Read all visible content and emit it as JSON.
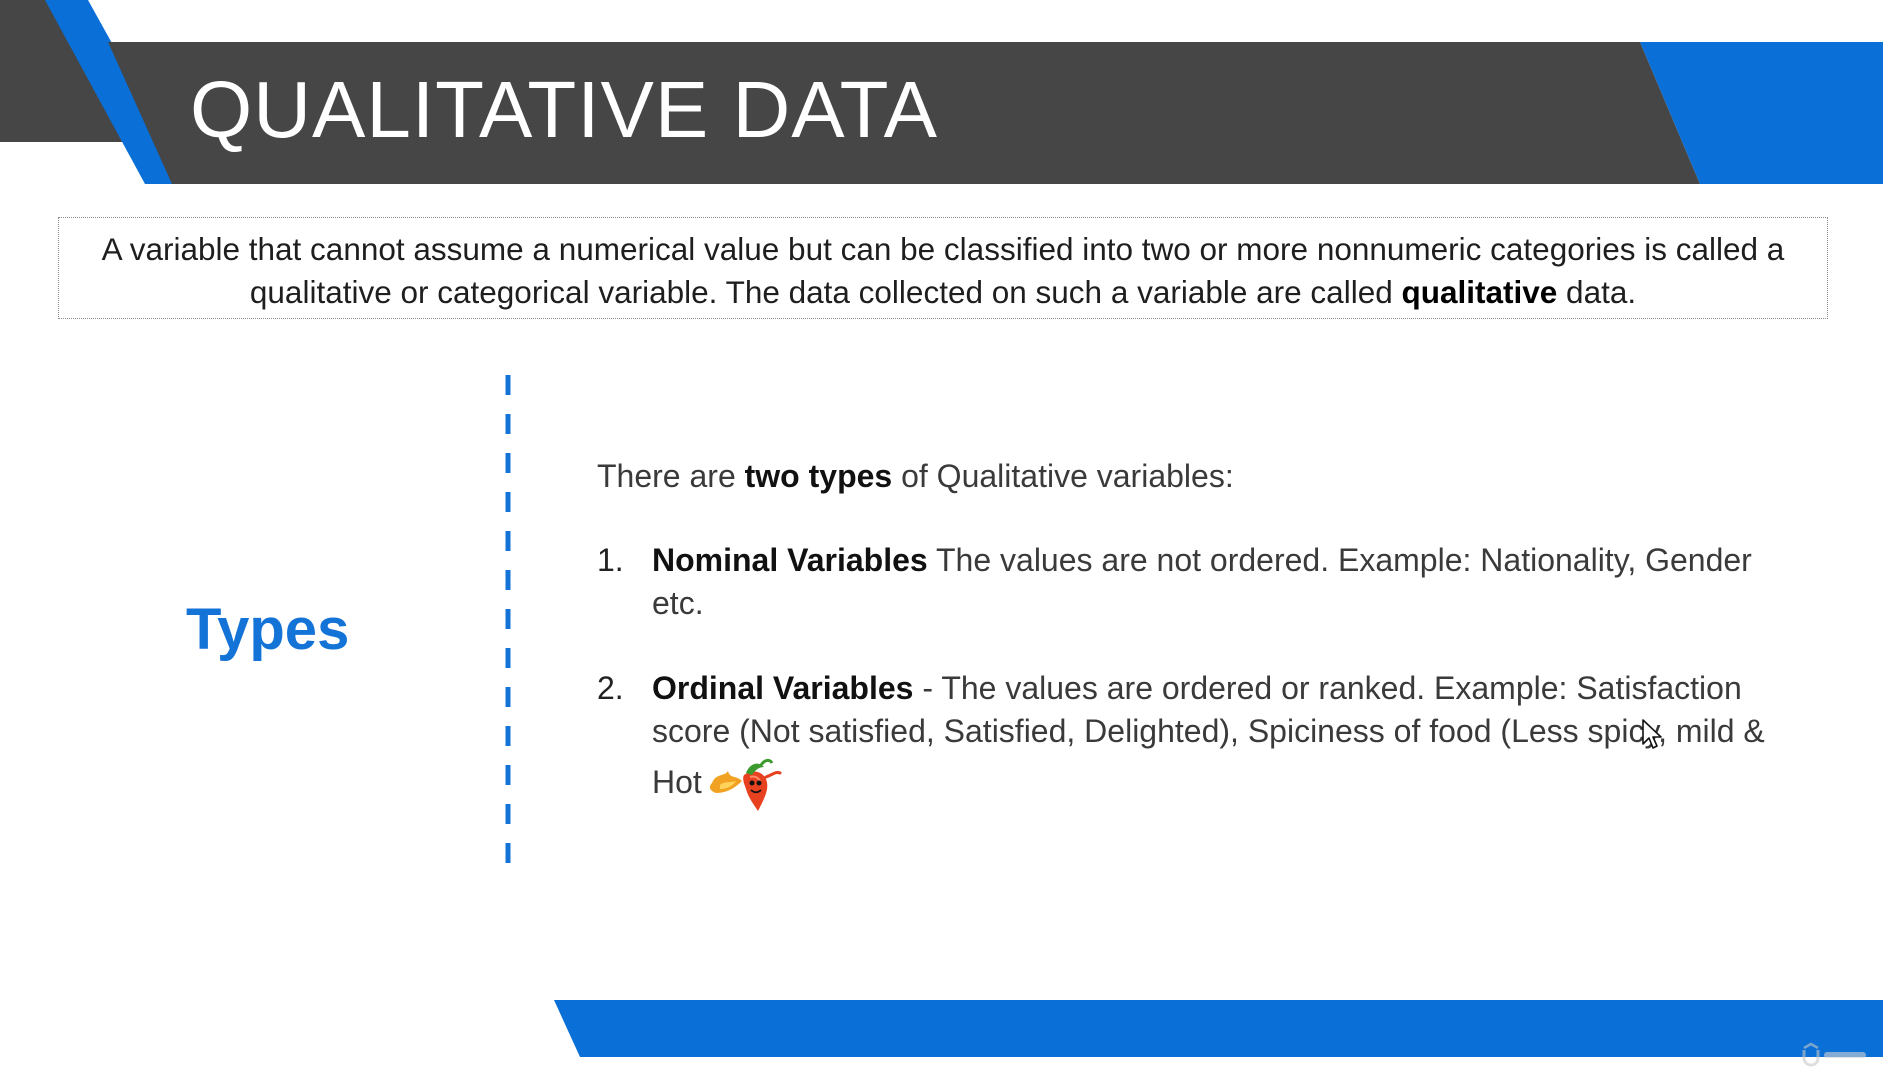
{
  "header": {
    "title": "QUALITATIVE DATA"
  },
  "definition": {
    "text_before": "A variable that cannot assume a numerical value but can be classified into two or more nonnumeric categories is called a qualitative or categorical variable. The data collected on such a variable are called ",
    "emphasis": "qualitative",
    "text_after": " data."
  },
  "section": {
    "heading": "Types"
  },
  "content": {
    "intro_before": "There are ",
    "intro_bold": "two types",
    "intro_after": " of Qualitative variables:",
    "items": [
      {
        "number": "1.",
        "term": "Nominal Variables",
        "description": " The values are not ordered. Example: Nationality, Gender etc."
      },
      {
        "number": "2.",
        "term": "Ordinal Variables",
        "description": "  - The values are ordered or ranked. Example: Satisfaction score (Not satisfied, Satisfied, Delighted), Spiciness of food (Less spicy, mild & Hot"
      }
    ]
  },
  "icons": {
    "item_icon": "chili-pepper-icon",
    "pointer": "mouse-cursor-icon",
    "watermark": "udemy-watermark-icon"
  },
  "colors": {
    "accent_blue": "#0a6fd6",
    "header_gray": "#464646",
    "heading_blue": "#1473d6"
  }
}
